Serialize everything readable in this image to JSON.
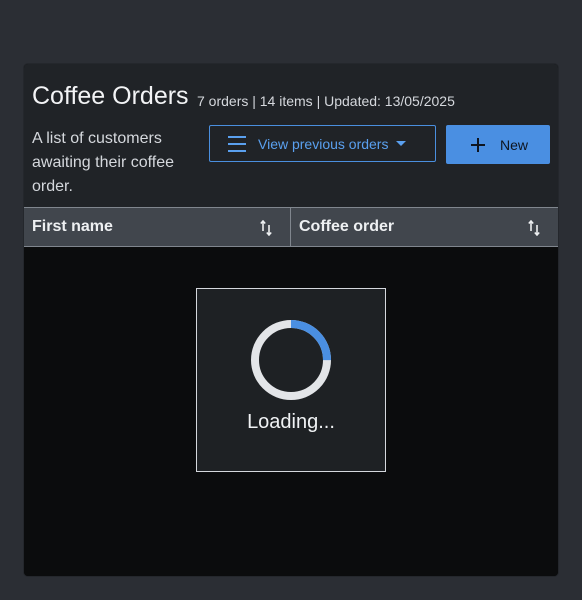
{
  "header": {
    "title": "Coffee Orders",
    "meta": "7 orders | 14 items | Updated: 13/05/2025",
    "description": "A list of customers awaiting their coffee order."
  },
  "toolbar": {
    "view_previous_label": "View previous orders",
    "new_label": "New"
  },
  "table": {
    "columns": [
      {
        "label": "First name"
      },
      {
        "label": "Coffee order"
      }
    ]
  },
  "loading": {
    "text": "Loading...",
    "progress": 0.25
  },
  "colors": {
    "accent": "#4a8fe2",
    "background": "#2b2e34",
    "panel": "#0b0c0d",
    "header": "#202327",
    "table_head": "#41464d"
  },
  "icons": {
    "menu": "hamburger-icon",
    "dropdown": "caret-down-icon",
    "add": "plus-icon",
    "sort": "sort-icon",
    "spinner": "spinner-icon"
  }
}
